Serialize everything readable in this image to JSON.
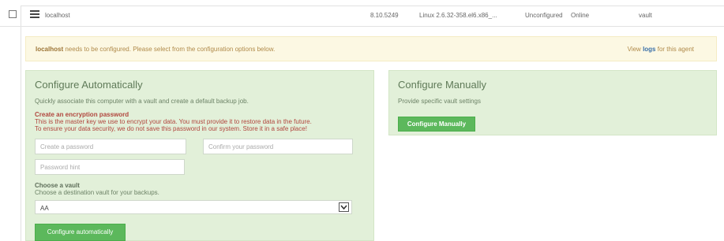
{
  "agent_row": {
    "hostname": "localhost",
    "version": "8.10.5249",
    "os": "Linux 2.6.32-358.el6.x86_...",
    "config_status": "Unconfigured",
    "online_status": "Online",
    "vault": "vault"
  },
  "warning": {
    "host": "localhost",
    "message": " needs to be configured. Please select from the configuration options below.",
    "right_prefix": "View ",
    "logs_link": "logs",
    "right_suffix": " for this agent"
  },
  "auto": {
    "title": "Configure Automatically",
    "subtitle": "Quickly associate this computer with a vault and create a default backup job.",
    "encryption_title": "Create an encryption password",
    "encryption_line1": "This is the master key we use to encrypt your data. You must provide it to restore data in the future.",
    "encryption_line2": "To ensure your data security, we do not save this password in our system. Store it in a safe place!",
    "password_placeholder": "Create a password",
    "confirm_placeholder": "Confirm your password",
    "hint_placeholder": "Password hint",
    "vault_title": "Choose a vault",
    "vault_subtitle": "Choose a destination vault for your backups.",
    "vault_selected": "AA",
    "button_label": "Configure automatically"
  },
  "manual": {
    "title": "Configure Manually",
    "subtitle": "Provide specific vault settings",
    "button_label": "Configure Manually"
  },
  "icons": [
    "checkbox",
    "server-icon",
    "chevron-down-icon"
  ],
  "colors": {
    "panel_bg": "#e2f0d9",
    "warning_bg": "#fcf8e3",
    "button": "#5cb85c",
    "error_text": "#b1463e"
  }
}
